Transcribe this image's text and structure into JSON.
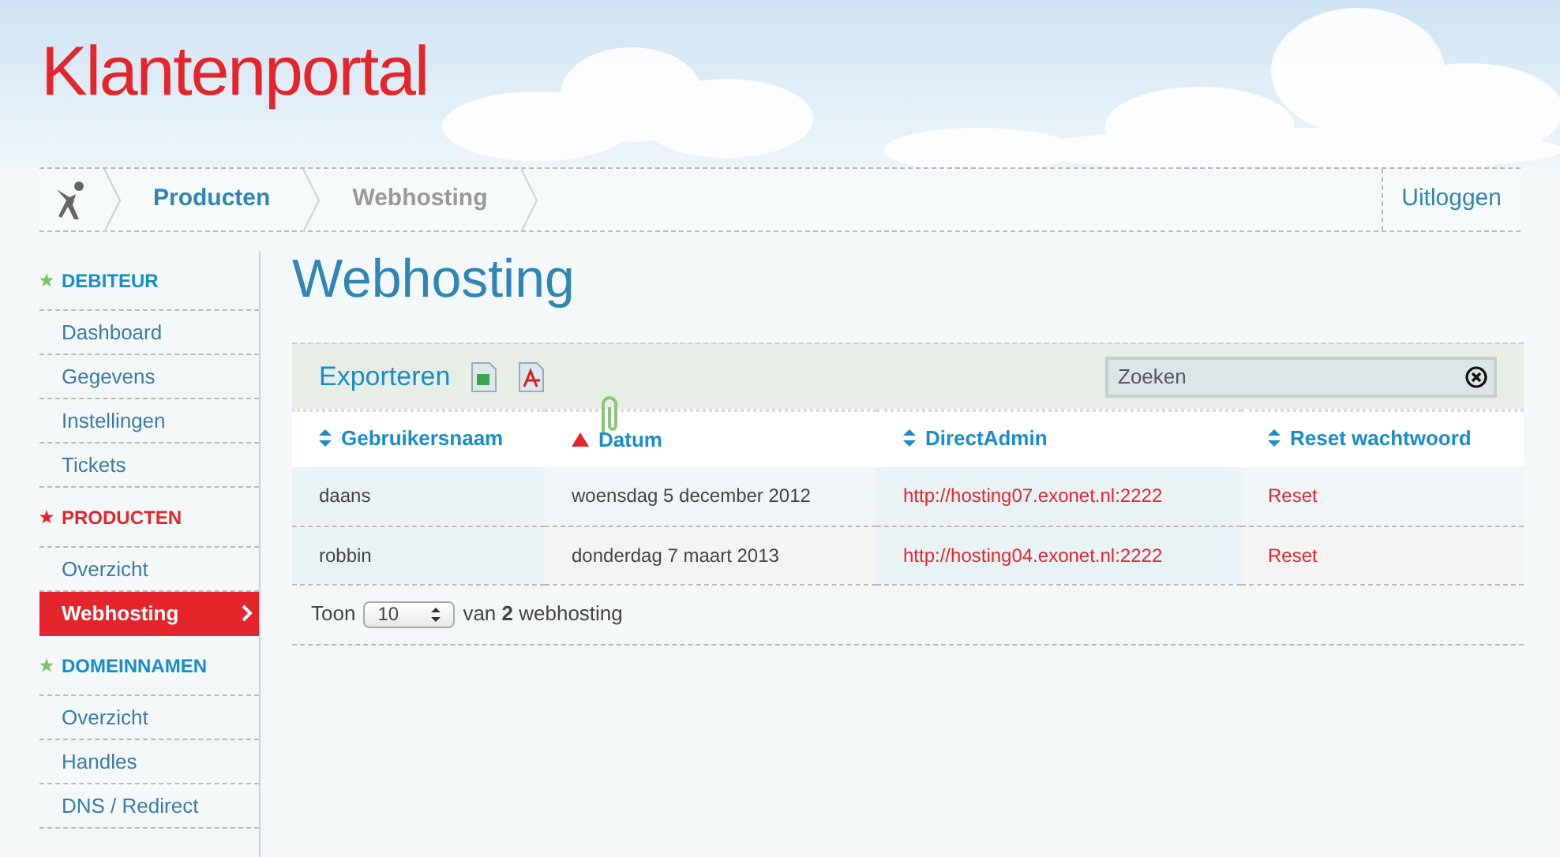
{
  "header": {
    "title": "Klantenportal"
  },
  "breadcrumb": {
    "items": [
      {
        "label": "Producten",
        "selected": false
      },
      {
        "label": "Webhosting",
        "selected": true
      }
    ],
    "logout": "Uitloggen"
  },
  "sidebar": {
    "groups": [
      {
        "title": "DEBITEUR",
        "selected": false,
        "color": "#7cc36a",
        "items": [
          {
            "label": "Dashboard",
            "selected": false
          },
          {
            "label": "Gegevens",
            "selected": false
          },
          {
            "label": "Instellingen",
            "selected": false
          },
          {
            "label": "Tickets",
            "selected": false
          }
        ]
      },
      {
        "title": "PRODUCTEN",
        "selected": true,
        "color": "#e4262c",
        "items": [
          {
            "label": "Overzicht",
            "selected": false
          },
          {
            "label": "Webhosting",
            "selected": true
          }
        ]
      },
      {
        "title": "DOMEINNAMEN",
        "selected": false,
        "color": "#7cc36a",
        "items": [
          {
            "label": "Overzicht",
            "selected": false
          },
          {
            "label": "Handles",
            "selected": false
          },
          {
            "label": "DNS / Redirect",
            "selected": false
          }
        ]
      }
    ]
  },
  "page_title": "Webhosting",
  "toolbar": {
    "export_label": "Exporteren",
    "search": {
      "placeholder": "Zoeken"
    }
  },
  "table": {
    "columns": [
      {
        "label": "Gebruikersnaam",
        "sorted": false
      },
      {
        "label": "Datum",
        "sorted": true
      },
      {
        "label": "DirectAdmin",
        "sorted": false
      },
      {
        "label": "Reset wachtwoord",
        "sorted": false
      }
    ],
    "rows": [
      [
        "daans",
        "woensdag 5 december 2012",
        "http://hosting07.exonet.nl:2222",
        "Reset"
      ],
      [
        "robbin",
        "donderdag 7 maart 2013",
        "http://hosting04.exonet.nl:2222",
        "Reset"
      ]
    ]
  },
  "pager": {
    "label": "Toon",
    "value": "10",
    "summary": "van **2** webhosting"
  }
}
